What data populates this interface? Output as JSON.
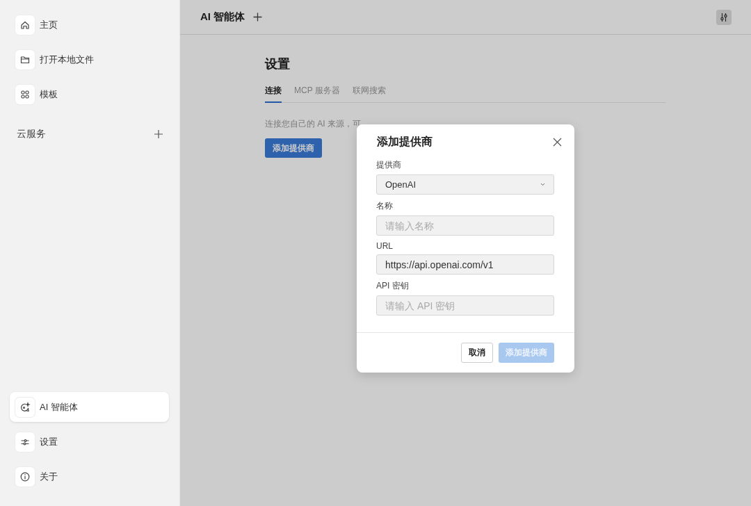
{
  "sidebar": {
    "top_items": [
      {
        "label": "主页",
        "kind": "home",
        "selected": false
      },
      {
        "label": "打开本地文件",
        "kind": "folder",
        "selected": false
      },
      {
        "label": "模板",
        "kind": "grid",
        "selected": false
      }
    ],
    "section": {
      "title": "云服务"
    },
    "bottom_items": [
      {
        "label": "AI 智能体",
        "kind": "agent",
        "selected": true
      },
      {
        "label": "设置",
        "kind": "sliders",
        "selected": false
      },
      {
        "label": "关于",
        "kind": "info",
        "selected": false
      }
    ]
  },
  "header": {
    "title": "AI 智能体"
  },
  "settings": {
    "title": "设置",
    "tabs": [
      {
        "label": "连接",
        "selected": true
      },
      {
        "label": "MCP 服务器",
        "selected": false
      },
      {
        "label": "联网搜索",
        "selected": false
      }
    ],
    "description": "连接您自己的 AI 来源，可",
    "add_button": "添加提供商"
  },
  "dialog": {
    "title": "添加提供商",
    "fields": [
      {
        "kind": "select",
        "label": "提供商",
        "value": "OpenAI"
      },
      {
        "kind": "input",
        "label": "名称",
        "placeholder": "请输入名称"
      },
      {
        "kind": "input",
        "label": "URL",
        "value": "https://api.openai.com/v1"
      },
      {
        "kind": "input",
        "label": "API 密钥",
        "placeholder": "请输入 API 密钥"
      }
    ],
    "buttons": [
      {
        "label": "取消",
        "disabled": false,
        "kind": "secondary"
      },
      {
        "label": "添加提供商",
        "disabled": true,
        "kind": "primary"
      }
    ]
  }
}
